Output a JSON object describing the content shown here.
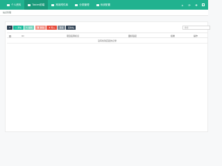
{
  "topbar": {
    "nav": [
      {
        "label": "个人资料",
        "icon": "user-icon",
        "active": false
      },
      {
        "label": "Tablet前端",
        "icon": "tablet-icon",
        "active": true
      },
      {
        "label": "常用附件库",
        "icon": "folder-icon",
        "active": false
      },
      {
        "label": "分类管理",
        "icon": "list-icon",
        "active": false
      },
      {
        "label": "系统配置",
        "icon": "cog-icon",
        "active": false
      }
    ],
    "right_icons": [
      "home-icon",
      "refresh-icon",
      "expand-icon",
      "fullscreen-icon"
    ]
  },
  "breadcrumb": "站点管理",
  "toolbar": {
    "refresh": "⟳",
    "add": "+ 添加",
    "edit": "✎ 编辑",
    "delete": "🗑 删除",
    "import": "⬆ 导入",
    "more": "更多",
    "recycle": "回收站"
  },
  "search": {
    "placeholder": "搜索"
  },
  "table": {
    "columns": [
      "ID",
      "项目名称标识",
      "图标链接",
      "权重",
      "操作"
    ],
    "empty_text": "没有找到匹配的记录"
  },
  "colors": {
    "brand": "#21b28f",
    "dark": "#2c3e50",
    "danger": "#e74c3c"
  }
}
